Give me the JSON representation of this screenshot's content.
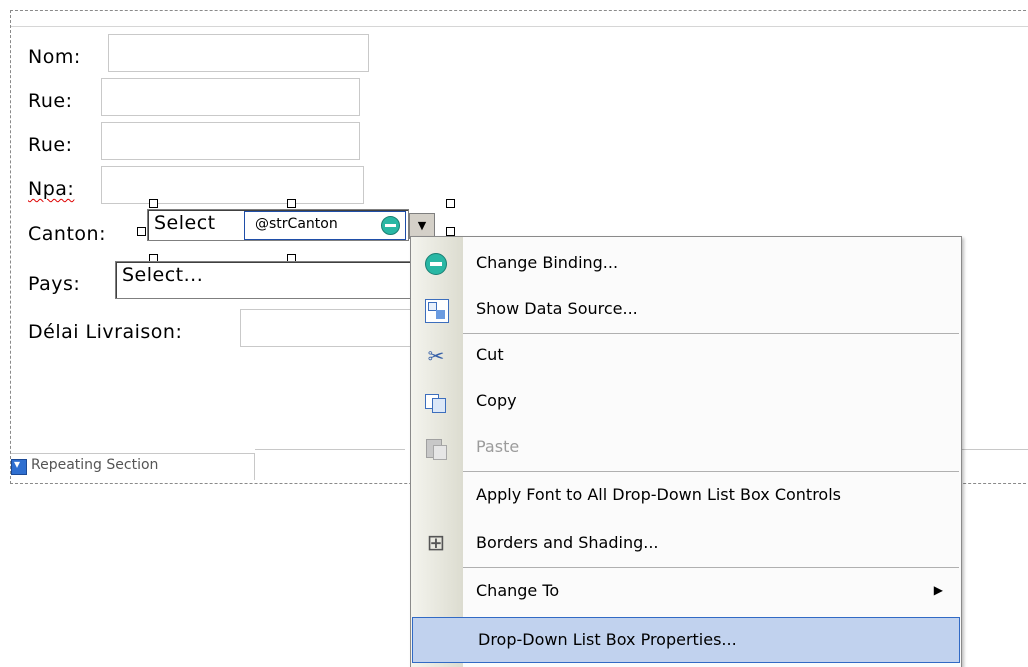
{
  "form": {
    "labels": {
      "nom": "Nom:",
      "rue1": "Rue:",
      "rue2": "Rue:",
      "npa": "Npa:",
      "canton": "Canton:",
      "pays": "Pays:",
      "delai": "Délai Livraison:"
    },
    "canton_select": "Select",
    "canton_binding": "@strCanton",
    "pays_select": "Select...",
    "repeating_section": "Repeating Section"
  },
  "context_menu": {
    "items": [
      {
        "label": "Change Binding...",
        "icon": "binding-icon",
        "enabled": true
      },
      {
        "label": "Show Data Source...",
        "icon": "data-source-icon",
        "enabled": true
      },
      {
        "label": "Cut",
        "icon": "scissors-icon",
        "enabled": true
      },
      {
        "label": "Copy",
        "icon": "copy-icon",
        "enabled": true
      },
      {
        "label": "Paste",
        "icon": "paste-icon",
        "enabled": false
      },
      {
        "label": "Apply Font to All Drop-Down List Box Controls",
        "icon": "",
        "enabled": true
      },
      {
        "label": "Borders and Shading...",
        "icon": "borders-icon",
        "enabled": true
      },
      {
        "label": "Change To",
        "icon": "",
        "enabled": true,
        "submenu": true
      },
      {
        "label": "Drop-Down List Box Properties...",
        "icon": "",
        "enabled": true,
        "selected": true
      }
    ]
  },
  "colors": {
    "selection_bg": "#c1d2ee",
    "selection_border": "#316ac5",
    "binding_teal": "#29b7a4"
  }
}
